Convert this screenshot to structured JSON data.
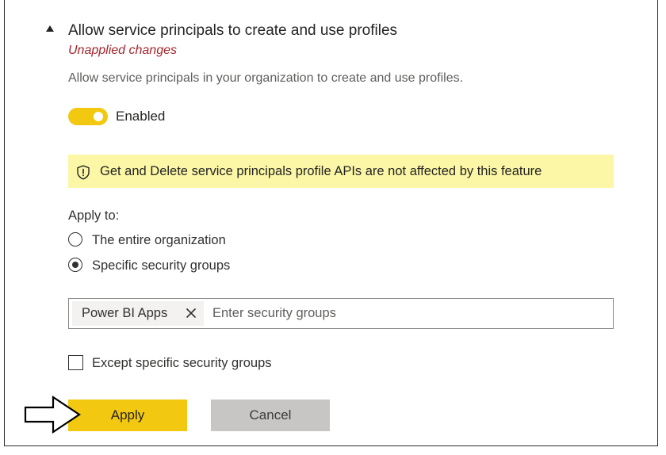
{
  "setting": {
    "title": "Allow service principals to create and use profiles",
    "status": "Unapplied changes",
    "description": "Allow service principals in your organization to create and use profiles.",
    "toggle": {
      "label": "Enabled",
      "state": "on"
    },
    "info_banner": {
      "icon": "shield-icon",
      "text": "Get and Delete service principals profile APIs are not affected by this feature"
    },
    "apply_to": {
      "label": "Apply to:",
      "options": [
        {
          "label": "The entire organization",
          "selected": false
        },
        {
          "label": "Specific security groups",
          "selected": true
        }
      ]
    },
    "security_groups": {
      "selected_chips": [
        "Power BI Apps"
      ],
      "placeholder": "Enter security groups",
      "value": ""
    },
    "except_groups": {
      "label": "Except specific security groups",
      "checked": false
    },
    "buttons": {
      "apply": "Apply",
      "cancel": "Cancel"
    }
  },
  "colors": {
    "accent": "#f2c811",
    "banner_background": "#fbf7a6",
    "status_red": "#a4262c",
    "cancel_gray": "#c8c6c4"
  }
}
